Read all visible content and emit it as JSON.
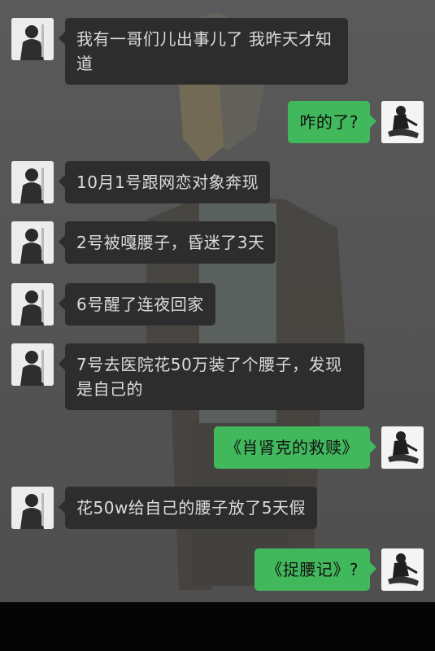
{
  "chat": {
    "messages": [
      {
        "side": "left",
        "avatar": "friend-avatar",
        "text": "我有一哥们儿出事儿了 我昨天才知道"
      },
      {
        "side": "right",
        "avatar": "user-avatar",
        "text": "咋的了?"
      },
      {
        "side": "left",
        "avatar": "friend-avatar",
        "text": "10月1号跟网恋对象奔现"
      },
      {
        "side": "left",
        "avatar": "friend-avatar",
        "text": "2号被嘎腰子，昏迷了3天"
      },
      {
        "side": "left",
        "avatar": "friend-avatar",
        "text": "6号醒了连夜回家"
      },
      {
        "side": "left",
        "avatar": "friend-avatar",
        "text": "7号去医院花50万装了个腰子，发现是自己的"
      },
      {
        "side": "right",
        "avatar": "user-avatar",
        "text": "《肖肾克的救赎》"
      },
      {
        "side": "left",
        "avatar": "friend-avatar",
        "text": "花50w给自己的腰子放了5天假"
      },
      {
        "side": "right",
        "avatar": "user-avatar",
        "text": "《捉腰记》?"
      }
    ]
  },
  "colors": {
    "background": "#555555",
    "incoming_bubble": "#2d2d2d",
    "outgoing_bubble": "#42b85d"
  }
}
